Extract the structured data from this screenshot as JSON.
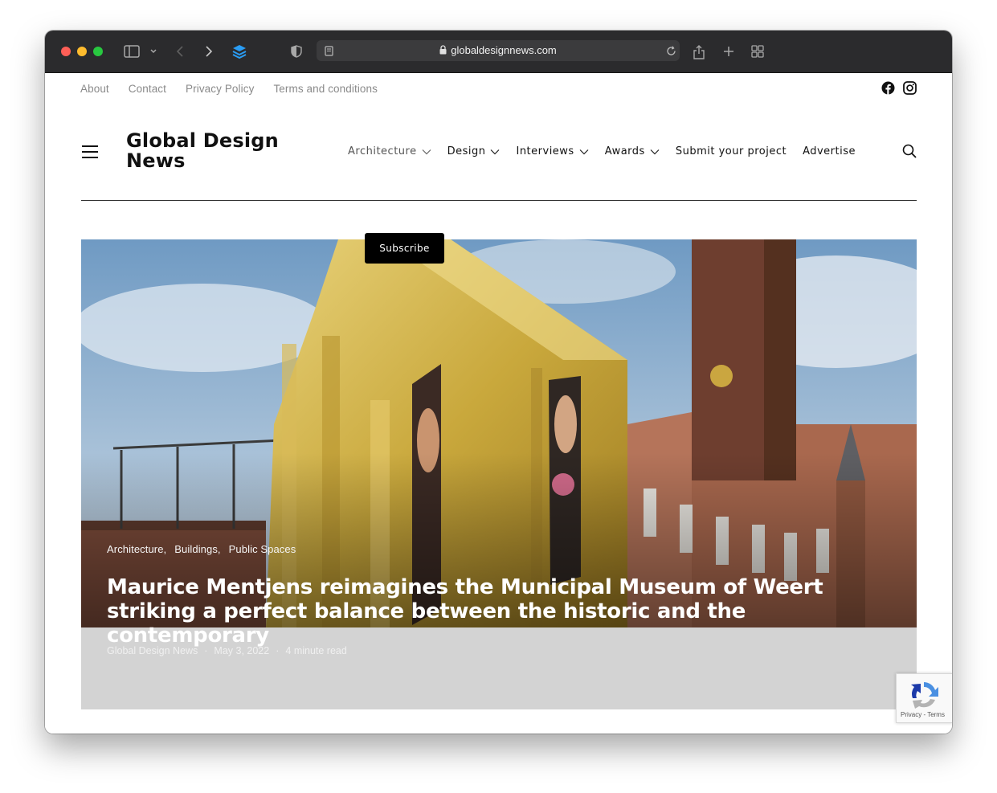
{
  "browser": {
    "url": "globaldesignnews.com"
  },
  "top_links": [
    "About",
    "Contact",
    "Privacy Policy",
    "Terms and conditions"
  ],
  "social_icons": [
    "facebook-icon",
    "instagram-icon"
  ],
  "site": {
    "logo_line1": "Global Design",
    "logo_line2": "News"
  },
  "main_nav": [
    {
      "label": "Architecture",
      "has_dropdown": true
    },
    {
      "label": "Design",
      "has_dropdown": true
    },
    {
      "label": "Interviews",
      "has_dropdown": true
    },
    {
      "label": "Awards",
      "has_dropdown": true
    },
    {
      "label": "Submit your project",
      "has_dropdown": false
    },
    {
      "label": "Advertise",
      "has_dropdown": false
    }
  ],
  "subscribe_label": "Subscribe",
  "featured": {
    "categories": [
      "Architecture,",
      "Buildings,",
      "Public Spaces"
    ],
    "title": "Maurice Mentjens reimagines the Municipal Museum of Weert striking a perfect balance between the historic and the contemporary",
    "author": "Global Design News",
    "date": "May 3, 2022",
    "read_time": "4 minute read"
  },
  "recaptcha": {
    "links": "Privacy - Terms"
  },
  "colors": {
    "toolbar": "#2b2b2d",
    "accent_black": "#000000",
    "hero_footer_gray": "#d3d3d3"
  }
}
